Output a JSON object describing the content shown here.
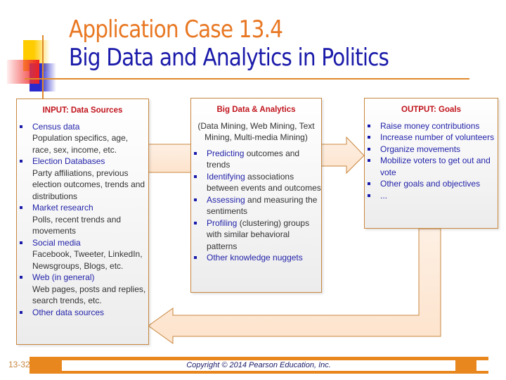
{
  "slide": {
    "title_line1": "Application Case 13.4",
    "title_line2": "Big Data and Analytics in Politics",
    "page_number": "13-32",
    "copyright": "Copyright © 2014 Pearson Education, Inc.",
    "colors": {
      "title_orange": "#e87722",
      "title_blue": "#1a1aaa",
      "box_title_red": "#c0141c",
      "accent_orange": "#e8871e"
    }
  },
  "input": {
    "title": "INPUT: Data Sources",
    "items": [
      {
        "label": "Census data",
        "detail": "Population specifics, age, race, sex, income, etc."
      },
      {
        "label": "Election Databases",
        "detail": "Party affiliations, previous election outcomes, trends and distributions"
      },
      {
        "label": "Market research",
        "detail": "Polls, recent trends and movements"
      },
      {
        "label": "Social media",
        "detail": "Facebook, Tweeter, LinkedIn, Newsgroups, Blogs, etc."
      },
      {
        "label": "Web (in general)",
        "detail": "Web pages, posts and replies, search trends, etc."
      },
      {
        "label": "Other data sources",
        "detail": ""
      }
    ]
  },
  "analytics": {
    "title": "Big Data & Analytics",
    "intro": "(Data Mining, Web Mining, Text Mining, Multi-media Mining)",
    "items": [
      {
        "key": "Predicting",
        "rest": " outcomes and trends"
      },
      {
        "key": "Identifying",
        "rest": " associations between events and outcomes"
      },
      {
        "key": "Assessing",
        "rest": " and measuring the sentiments"
      },
      {
        "key": "Profiling",
        "rest": " (clustering) groups with similar behavioral patterns"
      },
      {
        "key": "Other knowledge nuggets",
        "rest": ""
      }
    ]
  },
  "output": {
    "title": "OUTPUT: Goals",
    "items": [
      "Raise money contributions",
      "Increase number of volunteers",
      "Organize movements",
      "Mobilize voters to get out and vote",
      "Other goals and objectives",
      "..."
    ]
  }
}
